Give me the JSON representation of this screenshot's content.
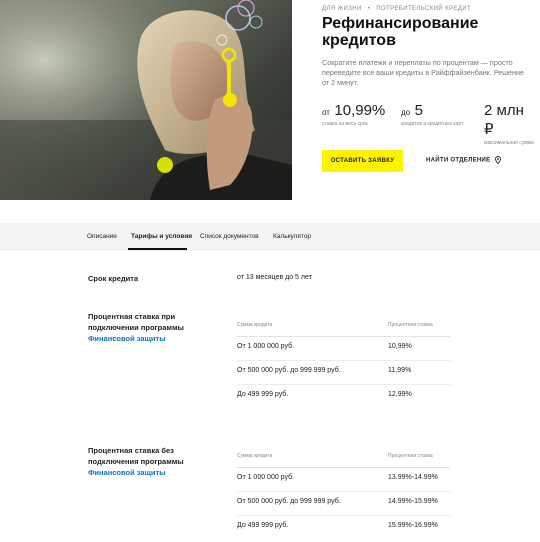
{
  "hero": {
    "eyebrow_left": "ДЛЯ ЖИЗНИ",
    "eyebrow_sep": "•",
    "eyebrow_right": "ПОТРЕБИТЕЛЬСКИЙ КРЕДИТ",
    "title": "Рефинансирование кредитов",
    "description": "Сократите платежи и переплаты по процентам — просто переведите все ваши кредиты в Райффайзенбанк. Решение от 2 минут.",
    "stats": [
      {
        "prefix": "от",
        "value": "10,99%",
        "caption": "ставка на весь срок"
      },
      {
        "prefix": "до",
        "value": "5",
        "caption": "кредитов в кредитных карт"
      },
      {
        "prefix": "",
        "value": "2 млн ₽",
        "caption": "максимальная сумма"
      }
    ],
    "apply_label": "ОСТАВИТЬ ЗАЯВКУ",
    "branch_label": "НАЙТИ ОТДЕЛЕНИЕ",
    "accent_color": "#fff200"
  },
  "tabs": [
    {
      "label": "Описание",
      "active": false
    },
    {
      "label": "Тарифы и условия",
      "active": true
    },
    {
      "label": "Список документов",
      "active": false
    },
    {
      "label": "Калькулятор",
      "active": false
    }
  ],
  "conditions": {
    "term": {
      "label": "Срок кредита",
      "value": "от 13 месяцев до 5 лет"
    },
    "with_protection": {
      "label": "Процентная ставка при подключении программы",
      "link": "Финансовой защиты",
      "col_amount": "Сумма кредита",
      "col_rate": "Процентная ставка",
      "rows": [
        {
          "amount": "От 1 000 000 руб.",
          "rate": "10,99%"
        },
        {
          "amount": "От 500 000 руб. до 999 999 руб.",
          "rate": "11,99%"
        },
        {
          "amount": "До 499 999 руб.",
          "rate": "12,99%"
        }
      ]
    },
    "without_protection": {
      "label": "Процентная ставка без подключения программы",
      "link": "Финансовой защиты",
      "col_amount": "Сумма кредита",
      "col_rate": "Процентная ставка",
      "rows": [
        {
          "amount": "От 1 000 000 руб.",
          "rate": "13.99%-14.99%"
        },
        {
          "amount": "От 500 000 руб. до 999 999 руб.",
          "rate": "14.99%-15.99%"
        },
        {
          "amount": "До 499 999 руб.",
          "rate": "15.99%-16.99%"
        }
      ]
    }
  }
}
